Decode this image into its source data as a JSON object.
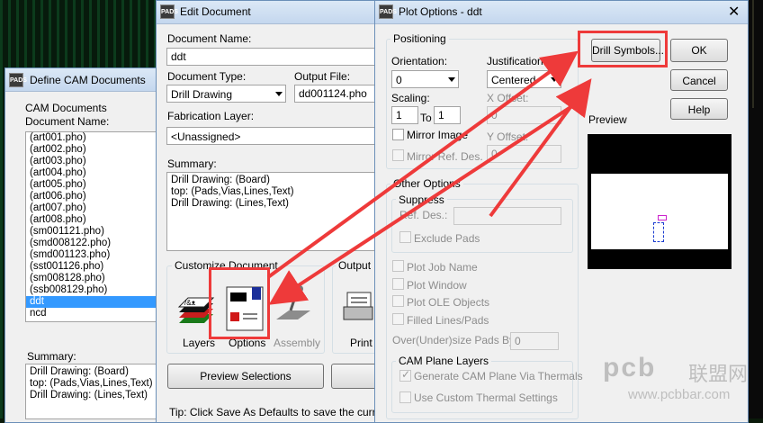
{
  "define_cam": {
    "title": "Define CAM Documents",
    "group_label": "CAM Documents",
    "doc_name_label": "Document Name:",
    "documents": [
      "(art001.pho)",
      "(art002.pho)",
      "(art003.pho)",
      "(art004.pho)",
      "(art005.pho)",
      "(art006.pho)",
      "(art007.pho)",
      "(art008.pho)",
      "(sm001121.pho)",
      "(smd008122.pho)",
      "(smd001123.pho)",
      "(sst001126.pho)",
      "(sm008128.pho)",
      "(ssb008129.pho)",
      "ddt",
      "ncd"
    ],
    "selected_index": 14,
    "summary_label": "Summary:",
    "summary_lines": [
      "Drill Drawing: (Board)",
      "top: (Pads,Vias,Lines,Text)",
      "Drill Drawing: (Lines,Text)"
    ]
  },
  "edit_doc": {
    "title": "Edit Document",
    "doc_name_label": "Document Name:",
    "doc_name_value": "ddt",
    "doc_type_label": "Document Type:",
    "doc_type_value": "Drill Drawing",
    "output_file_label": "Output File:",
    "output_file_value": "dd001124.pho",
    "fab_layer_label": "Fabrication Layer:",
    "fab_layer_value": "<Unassigned>",
    "summary_label": "Summary:",
    "summary_lines": [
      "Drill Drawing: (Board)",
      "top: (Pads,Vias,Lines,Text)",
      "Drill Drawing: (Lines,Text)"
    ],
    "customize_label": "Customize Document",
    "output_label": "Output I",
    "layers_label": "Layers",
    "options_label": "Options",
    "assembly_label": "Assembly",
    "print_label": "Print",
    "preview_btn": "Preview Selections",
    "tip": "Tip: Click Save As Defaults to save the current"
  },
  "plot_options": {
    "title": "Plot Options - ddt",
    "positioning_label": "Positioning",
    "orientation_label": "Orientation:",
    "orientation_value": "0",
    "justification_label": "Justification:",
    "justification_value": "Centered",
    "scaling_label": "Scaling:",
    "scale_a": "1",
    "to_label": "To",
    "scale_b": "1",
    "x_offset_label": "X Offset:",
    "x_offset_value": "0",
    "y_offset_label": "Y Offset:",
    "y_offset_value": "0",
    "mirror_image": "Mirror Image",
    "mirror_ref": "Mirror Ref. Des.",
    "other_options_label": "Other Options",
    "suppress_label": "Suppress",
    "ref_des_label": "Ref. Des.:",
    "exclude_pads": "Exclude Pads",
    "plot_job_name": "Plot Job Name",
    "plot_window": "Plot Window",
    "plot_ole": "Plot OLE Objects",
    "filled_lines": "Filled Lines/Pads",
    "oversize_label": "Over(Under)size Pads By:",
    "oversize_value": "0",
    "cam_plane_label": "CAM Plane Layers",
    "gen_cam_plane": "Generate CAM Plane Via Thermals",
    "custom_thermal": "Use Custom Thermal Settings",
    "drill_symbols_btn": "Drill Symbols...",
    "ok_btn": "OK",
    "cancel_btn": "Cancel",
    "help_btn": "Help",
    "preview_label": "Preview"
  },
  "watermark": {
    "brand": "pcb",
    "cn": "联盟网",
    "url": "www.pcbbar.com"
  },
  "colors": {
    "highlight": "#ee3a3a",
    "selection": "#3399ff"
  }
}
